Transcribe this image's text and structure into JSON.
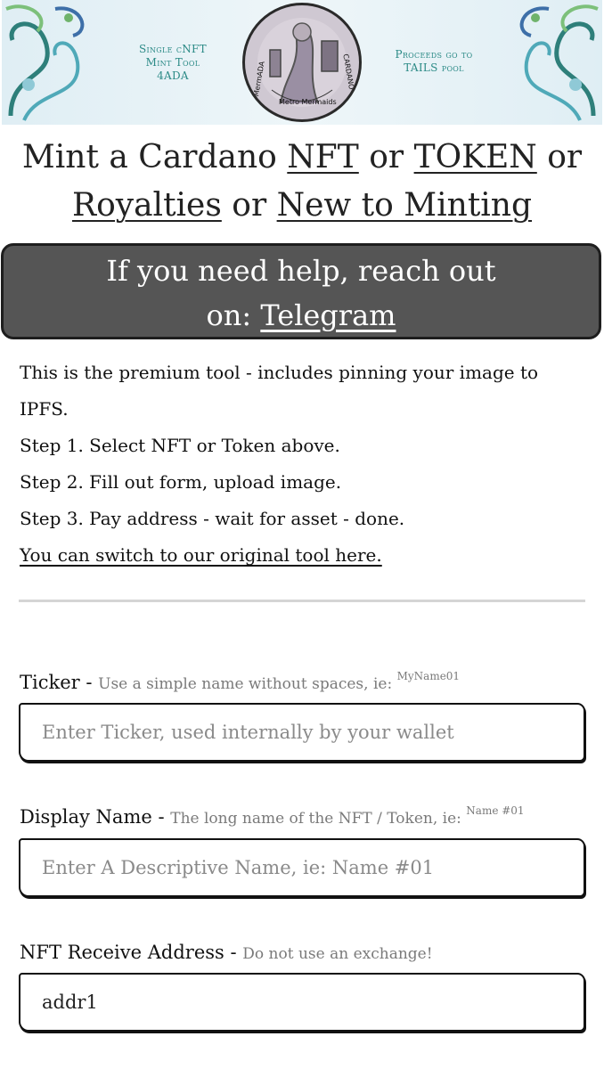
{
  "banner": {
    "left_text": [
      "Single cNFT",
      "Mint Tool",
      "4ADA"
    ],
    "right_text": [
      "Proceeds go to",
      "TAILS pool"
    ],
    "seal_text": {
      "bottom": "Metro Mermaids",
      "left": "MermADA",
      "right": "CARDANO"
    },
    "colors": {
      "accent": "#2b8a86",
      "banner_bg": "#e6f1f5"
    }
  },
  "heading": {
    "prefix": "Mint a Cardano ",
    "nft_link": "NFT",
    "or1": " or ",
    "token_link": "TOKEN",
    "or2": " or",
    "royalties_link": "Royalties",
    "or3": " or ",
    "new_link": "New to Minting"
  },
  "help": {
    "line1": "If you need help, reach out",
    "line2_prefix": "on: ",
    "telegram_link": "Telegram",
    "bg_color": "#555555"
  },
  "instructions": {
    "intro": "This is the premium tool - includes pinning your image to IPFS.",
    "step1": "Step 1. Select NFT or Token above.",
    "step2": "Step 2. Fill out form, upload image.",
    "step3": "Step 3. Pay address - wait for asset - done.",
    "switch_link": "You can switch to our original tool here."
  },
  "form": {
    "ticker": {
      "label": "Ticker - ",
      "hint": "Use a simple name without spaces, ie: ",
      "example": "MyName01",
      "placeholder": "Enter Ticker, used internally by your wallet",
      "value": ""
    },
    "display_name": {
      "label": "Display Name - ",
      "hint": "The long name of the NFT / Token, ie: ",
      "example": "Name #01",
      "placeholder": "Enter A Descriptive Name, ie: Name #01",
      "value": ""
    },
    "receive_address": {
      "label": "NFT Receive Address - ",
      "hint": "Do not use an exchange!",
      "value": "addr1"
    }
  }
}
